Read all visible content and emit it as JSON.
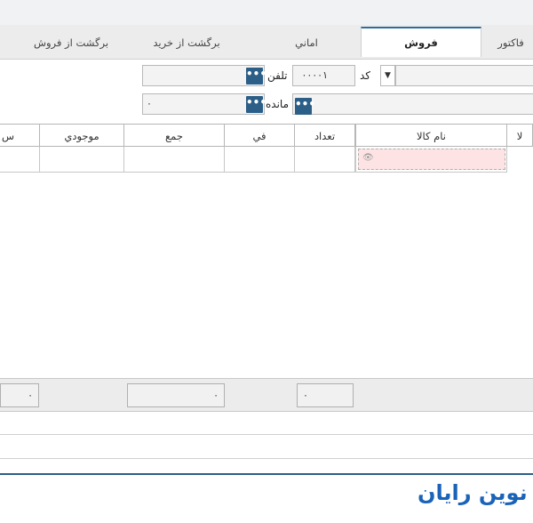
{
  "tabs": [
    {
      "label": "فاكتور",
      "active": false
    },
    {
      "label": "فروش",
      "active": true
    },
    {
      "label": "اماني",
      "active": false
    },
    {
      "label": "برگشت از خريد",
      "active": false
    },
    {
      "label": "برگشت از فروش",
      "active": false
    }
  ],
  "header": {
    "code_label": "كد",
    "code_value": "٠٠٠٠١",
    "phone_label": "تلفن",
    "phone_value": "",
    "balance_label": "مانده",
    "balance_value": "٠",
    "dots": "•••"
  },
  "grid": {
    "columns": [
      "نام كالا",
      "تعداد",
      "في",
      "جمع",
      "موجودي"
    ],
    "right_edge_header": "لا",
    "left_edge_header": "س"
  },
  "summary": {
    "values": [
      "٠",
      "٠",
      "٠"
    ]
  },
  "brand": {
    "text": "نوين رايان",
    "color": "#1a63b8",
    "accent": "#2b5f88"
  }
}
